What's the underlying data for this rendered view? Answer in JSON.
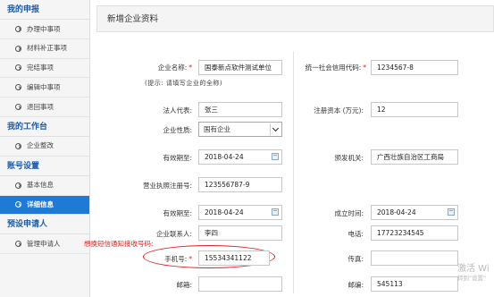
{
  "sidebar": {
    "sections": [
      {
        "title": "我的申报",
        "items": [
          "办理中事项",
          "材料补正事项",
          "完结事项",
          "编辑中事项",
          "退回事项"
        ]
      },
      {
        "title": "我的工作台",
        "items": [
          "企业整改"
        ]
      },
      {
        "title": "账号设置",
        "items": [
          "基本信息",
          "详细信息"
        ]
      },
      {
        "title": "预设申请人",
        "items": [
          "管理申请人"
        ]
      }
    ],
    "active_item": "详细信息"
  },
  "page": {
    "title": "新增企业资料"
  },
  "form": {
    "company_name": {
      "label": "企业名称:",
      "value": "国泰新点软件测试单位"
    },
    "credit_code": {
      "label": "统一社会信用代码:",
      "value": "1234567-8"
    },
    "name_hint": "(提示: 请填写企业的全称)",
    "legal_rep": {
      "label": "法人代表:",
      "value": "张三"
    },
    "capital": {
      "label": "注册资本 (万元):",
      "value": "12"
    },
    "nature": {
      "label": "企业性质:",
      "value": "国有企业"
    },
    "valid_to_1": {
      "label": "有效期至:",
      "value": "2018-04-24"
    },
    "issuer": {
      "label": "颁发机关:",
      "value": "广西壮族自治区工商局"
    },
    "license_no": {
      "label": "营业执照注册号:",
      "value": "123556787-9"
    },
    "valid_to_2": {
      "label": "有效期至:",
      "value": "2018-04-24"
    },
    "established": {
      "label": "成立时间:",
      "value": "2018-04-24"
    },
    "contact": {
      "label": "企业联系人:",
      "value": "李四"
    },
    "phone": {
      "label": "电话:",
      "value": "17723234545"
    },
    "mobile": {
      "label": "手机号:",
      "value": "15534341122"
    },
    "fax": {
      "label": "传真:",
      "value": ""
    },
    "email": {
      "label": "邮箱:",
      "value": ""
    },
    "postcode": {
      "label": "邮编:",
      "value": "545113"
    }
  },
  "annotation": {
    "text": "想换短信通知接收号码:"
  },
  "watermark": {
    "line1": "激活 Wi",
    "line2": "转到\"设置\""
  },
  "colors": {
    "accent": "#1e7ad6",
    "section_title": "#1a5aa6",
    "required": "#e02020"
  }
}
